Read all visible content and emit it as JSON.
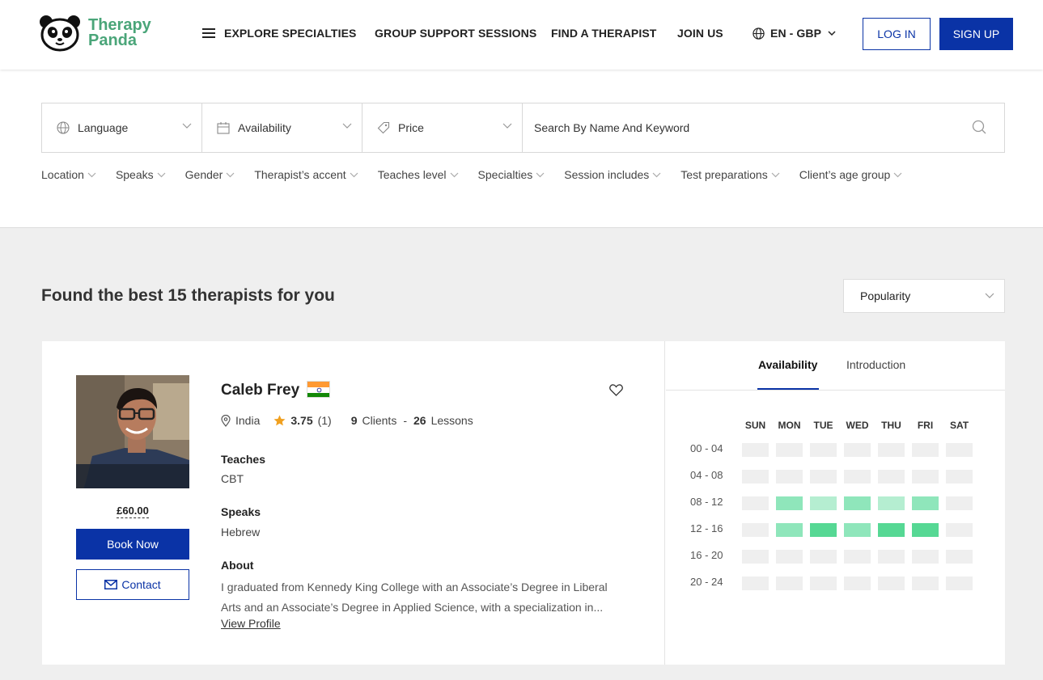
{
  "header": {
    "logo_line1": "Therapy",
    "logo_line2": "Panda",
    "nav": [
      "EXPLORE SPECIALTIES",
      "GROUP SUPPORT SESSIONS",
      "FIND A THERAPIST",
      "JOIN US"
    ],
    "locale": "EN - GBP",
    "login": "LOG IN",
    "signup": "SIGN UP"
  },
  "filters": {
    "language": "Language",
    "availability": "Availability",
    "price": "Price",
    "search_placeholder": "Search By Name And Keyword",
    "chips": [
      "Location",
      "Speaks",
      "Gender",
      "Therapist’s accent",
      "Teaches level",
      "Specialties",
      "Session includes",
      "Test preparations",
      "Client’s age group"
    ]
  },
  "results": {
    "title": "Found the best 15 therapists for you",
    "sort_selected": "Popularity"
  },
  "therapist": {
    "name": "Caleb Frey",
    "location": "India",
    "rating": "3.75",
    "reviews": "(1)",
    "clients_count": "9",
    "clients_label": "Clients",
    "separator": "-",
    "lessons_count": "26",
    "lessons_label": "Lessons",
    "teaches_label": "Teaches",
    "teaches_value": "CBT",
    "speaks_label": "Speaks",
    "speaks_value": "Hebrew",
    "about_label": "About",
    "about_text": "I graduated from Kennedy King College with an Associate’s Degree in Liberal Arts and an Associate’s Degree in Applied Science, with a specialization in...",
    "view_profile": "View Profile",
    "price": "£60.00",
    "book": "Book Now",
    "contact": "Contact"
  },
  "availability": {
    "tabs": [
      "Availability",
      "Introduction"
    ],
    "days": [
      "SUN",
      "MON",
      "TUE",
      "WED",
      "THU",
      "FRI",
      "SAT"
    ],
    "slots": [
      "00 - 04",
      "04 - 08",
      "08 - 12",
      "12 - 16",
      "16 - 20",
      "20 - 24"
    ],
    "levels": [
      [
        0,
        0,
        0,
        0,
        0,
        0,
        0
      ],
      [
        0,
        0,
        0,
        0,
        0,
        0,
        0
      ],
      [
        0,
        2,
        1,
        2,
        1,
        2,
        0
      ],
      [
        0,
        2,
        3,
        2,
        3,
        3,
        0
      ],
      [
        0,
        0,
        0,
        0,
        0,
        0,
        0
      ],
      [
        0,
        0,
        0,
        0,
        0,
        0,
        0
      ]
    ],
    "colors": [
      "#efefef",
      "#b5eed1",
      "#8fe6bb",
      "#56d894"
    ]
  },
  "colors": {
    "brand": "#0a33a6",
    "logo_green": "#4aa579",
    "star": "#f0a01f"
  }
}
